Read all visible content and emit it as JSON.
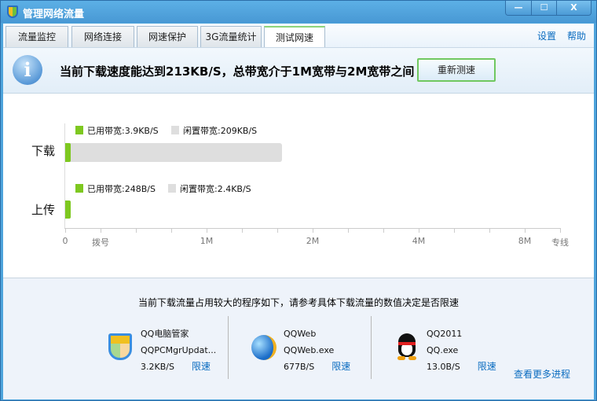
{
  "window": {
    "title": "管理网络流量",
    "minimize": "—",
    "maximize": "☐",
    "close": "X"
  },
  "tabs": [
    {
      "label": "流量监控"
    },
    {
      "label": "网络连接"
    },
    {
      "label": "网速保护"
    },
    {
      "label": "3G流量统计"
    },
    {
      "label": "测试网速",
      "active": true
    }
  ],
  "top_links": {
    "settings": "设置",
    "help": "帮助"
  },
  "info": {
    "icon": "info-icon",
    "glyph": "i",
    "message": "当前下载速度能达到213KB/S，总带宽介于1M宽带与2M宽带之间",
    "retest_button": "重新测速"
  },
  "colors": {
    "used": "#7ec820",
    "idle": "#dedede",
    "accent": "#4ea4dc",
    "link": "#0a6cc0"
  },
  "chart": {
    "download": {
      "label": "下载",
      "used_label": "已用带宽:3.9KB/S",
      "idle_label": "闲置带宽:209KB/S",
      "used_kbps": 3.9,
      "idle_kbps": 209
    },
    "upload": {
      "label": "上传",
      "used_label": "已用带宽:248B/S",
      "idle_label": "闲置带宽:2.4KB/S"
    },
    "axis_labels": [
      "0",
      "拨号",
      "1M",
      "2M",
      "4M",
      "8M",
      "专线"
    ]
  },
  "bottom": {
    "caption": "当前下载流量占用较大的程序如下，请参考具体下载流量的数值决定是否限速",
    "processes": [
      {
        "name": "QQ电脑管家",
        "exe": "QQPCMgrUpdat...",
        "speed": "3.2KB/S",
        "action": "限速",
        "icon": "shield-icon"
      },
      {
        "name": "QQWeb",
        "exe": "QQWeb.exe",
        "speed": "677B/S",
        "action": "限速",
        "icon": "globe-icon"
      },
      {
        "name": "QQ2011",
        "exe": "QQ.exe",
        "speed": "13.0B/S",
        "action": "限速",
        "icon": "penguin-icon"
      }
    ],
    "more_link": "查看更多进程"
  }
}
